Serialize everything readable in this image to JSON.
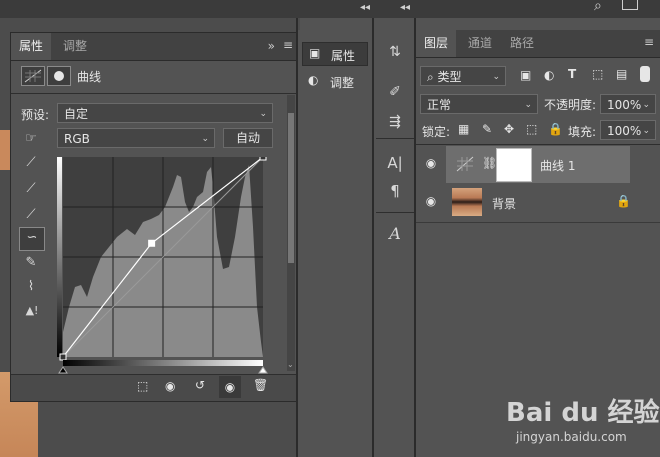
{
  "properties_panel": {
    "tabs": [
      "属性",
      "调整"
    ],
    "title": "曲线",
    "preset_label": "预设:",
    "preset_value": "自定",
    "channel_value": "RGB",
    "auto_button": "自动",
    "curve": {
      "type": "line",
      "points": [
        [
          0,
          0
        ],
        [
          113,
          145
        ],
        [
          255,
          255
        ]
      ],
      "input_range": [
        0,
        255
      ],
      "output_range": [
        0,
        255
      ]
    }
  },
  "middle_strip": {
    "items": [
      "属性",
      "调整"
    ]
  },
  "layers_panel": {
    "tabs": [
      "图层",
      "通道",
      "路径"
    ],
    "filter_label": "类型",
    "blend_mode": "正常",
    "opacity_label": "不透明度:",
    "opacity_value": "100%",
    "lock_label": "锁定:",
    "fill_label": "填充:",
    "fill_value": "100%",
    "layers": [
      {
        "name": "曲线 1",
        "kind": "adjustment",
        "visible": true,
        "selected": true
      },
      {
        "name": "背景",
        "kind": "image",
        "visible": true,
        "locked": true
      }
    ]
  },
  "watermark": {
    "brand": "Bai du 经验",
    "url": "jingyan.baidu.com"
  }
}
